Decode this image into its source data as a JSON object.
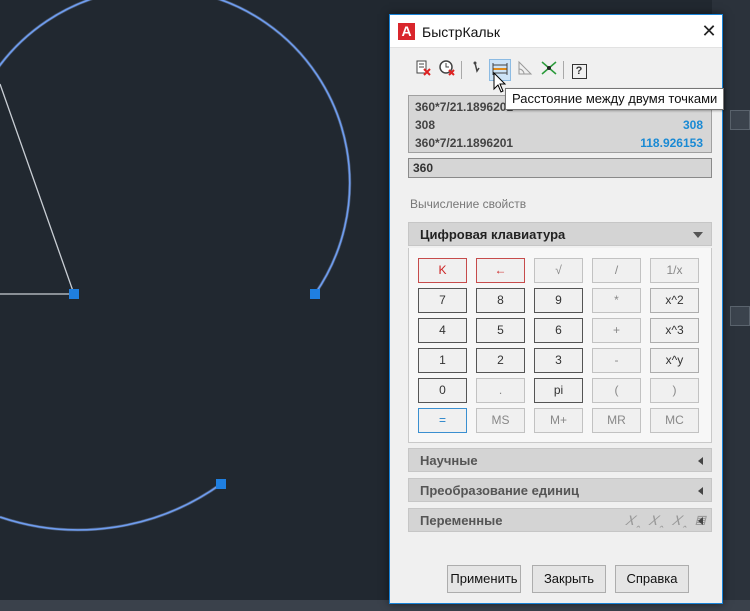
{
  "dialog": {
    "title": "БыстрКальк",
    "app_icon_letter": "A",
    "close_symbol": "✕"
  },
  "toolbar": {
    "buttons": [
      {
        "icon": "clear-icon"
      },
      {
        "icon": "clear-history-icon"
      },
      {
        "icon": "get-coordinates-icon"
      },
      {
        "icon": "distance-between-points-icon"
      },
      {
        "icon": "angle-of-line-icon"
      },
      {
        "icon": "intersection-icon"
      },
      {
        "icon": "help-icon",
        "label": "?"
      }
    ],
    "tooltip": "Расстояние между двумя точками"
  },
  "history": [
    {
      "expr": "360*7/21.1896201",
      "result": ""
    },
    {
      "expr": "308",
      "result": "308"
    },
    {
      "expr": "360*7/21.1896201",
      "result": "118.926153"
    }
  ],
  "input": {
    "value": "360"
  },
  "section_hint": "Вычисление свойств",
  "panels": {
    "keypad": "Цифровая клавиатура",
    "scientific": "Научные",
    "units": "Преобразование единиц",
    "variables": "Переменные"
  },
  "variables_icons": "𝑋ꞈ 𝑋ꞈ 𝑋ꞈ ▤",
  "keys": [
    [
      "K",
      "←",
      "√",
      "/",
      "1/x"
    ],
    [
      "7",
      "8",
      "9",
      "*",
      "x^2"
    ],
    [
      "4",
      "5",
      "6",
      "+",
      "x^3"
    ],
    [
      "1",
      "2",
      "3",
      "-",
      "x^y"
    ],
    [
      "0",
      ".",
      "pi",
      "(",
      ")"
    ],
    [
      "=",
      "MS",
      "M+",
      "MR",
      "MC"
    ]
  ],
  "footer": {
    "apply": "Применить",
    "close": "Закрыть",
    "help": "Справка"
  },
  "colors": {
    "canvas_bg": "#212830",
    "arc": "#5b8fe8",
    "grip": "#1f7fe0",
    "accent": "#1883d7"
  }
}
